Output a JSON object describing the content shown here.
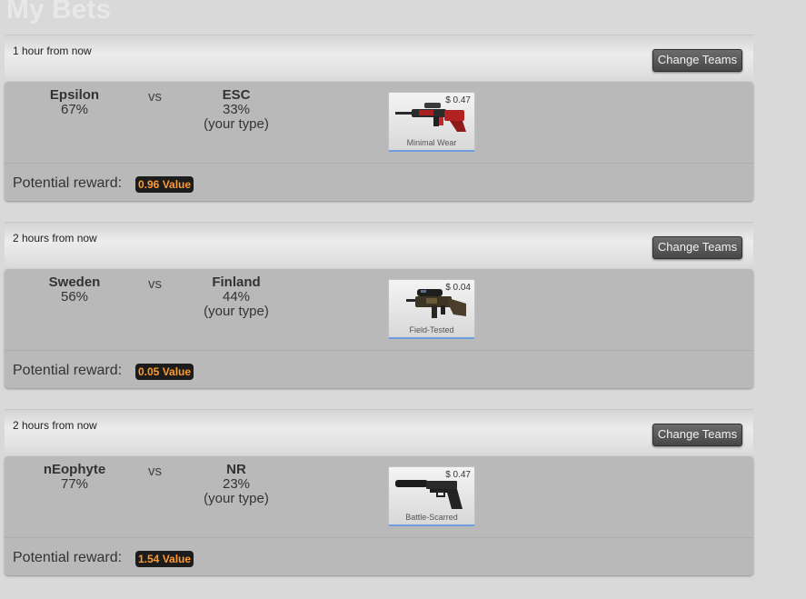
{
  "page": {
    "title": "My Bets"
  },
  "bets": [
    {
      "time": "1 hour from now",
      "change_label": "Change Teams",
      "team1": {
        "name": "Epsilon",
        "pct": "67%"
      },
      "vs": "vs",
      "team2": {
        "name": "ESC",
        "pct": "33%",
        "note": "(your type)"
      },
      "item": {
        "price": "$ 0.47",
        "wear": "Minimal Wear",
        "icon": "aug-rifle-icon"
      },
      "reward_label": "Potential reward:",
      "reward_value": "0.96 Value"
    },
    {
      "time": "2 hours from now",
      "change_label": "Change Teams",
      "team1": {
        "name": "Sweden",
        "pct": "56%"
      },
      "vs": "vs",
      "team2": {
        "name": "Finland",
        "pct": "44%",
        "note": "(your type)"
      },
      "item": {
        "price": "$ 0.04",
        "wear": "Field-Tested",
        "icon": "scar-rifle-icon"
      },
      "reward_label": "Potential reward:",
      "reward_value": "0.05 Value"
    },
    {
      "time": "2 hours from now",
      "change_label": "Change Teams",
      "team1": {
        "name": "nEophyte",
        "pct": "77%"
      },
      "vs": "vs",
      "team2": {
        "name": "NR",
        "pct": "23%",
        "note": "(your type)"
      },
      "item": {
        "price": "$ 0.47",
        "wear": "Battle-Scarred",
        "icon": "usp-pistol-icon"
      },
      "reward_label": "Potential reward:",
      "reward_value": "1.54 Value"
    }
  ],
  "colors": {
    "reward_text": "#ff9a2e",
    "item_underline": "#6f9ee0"
  }
}
